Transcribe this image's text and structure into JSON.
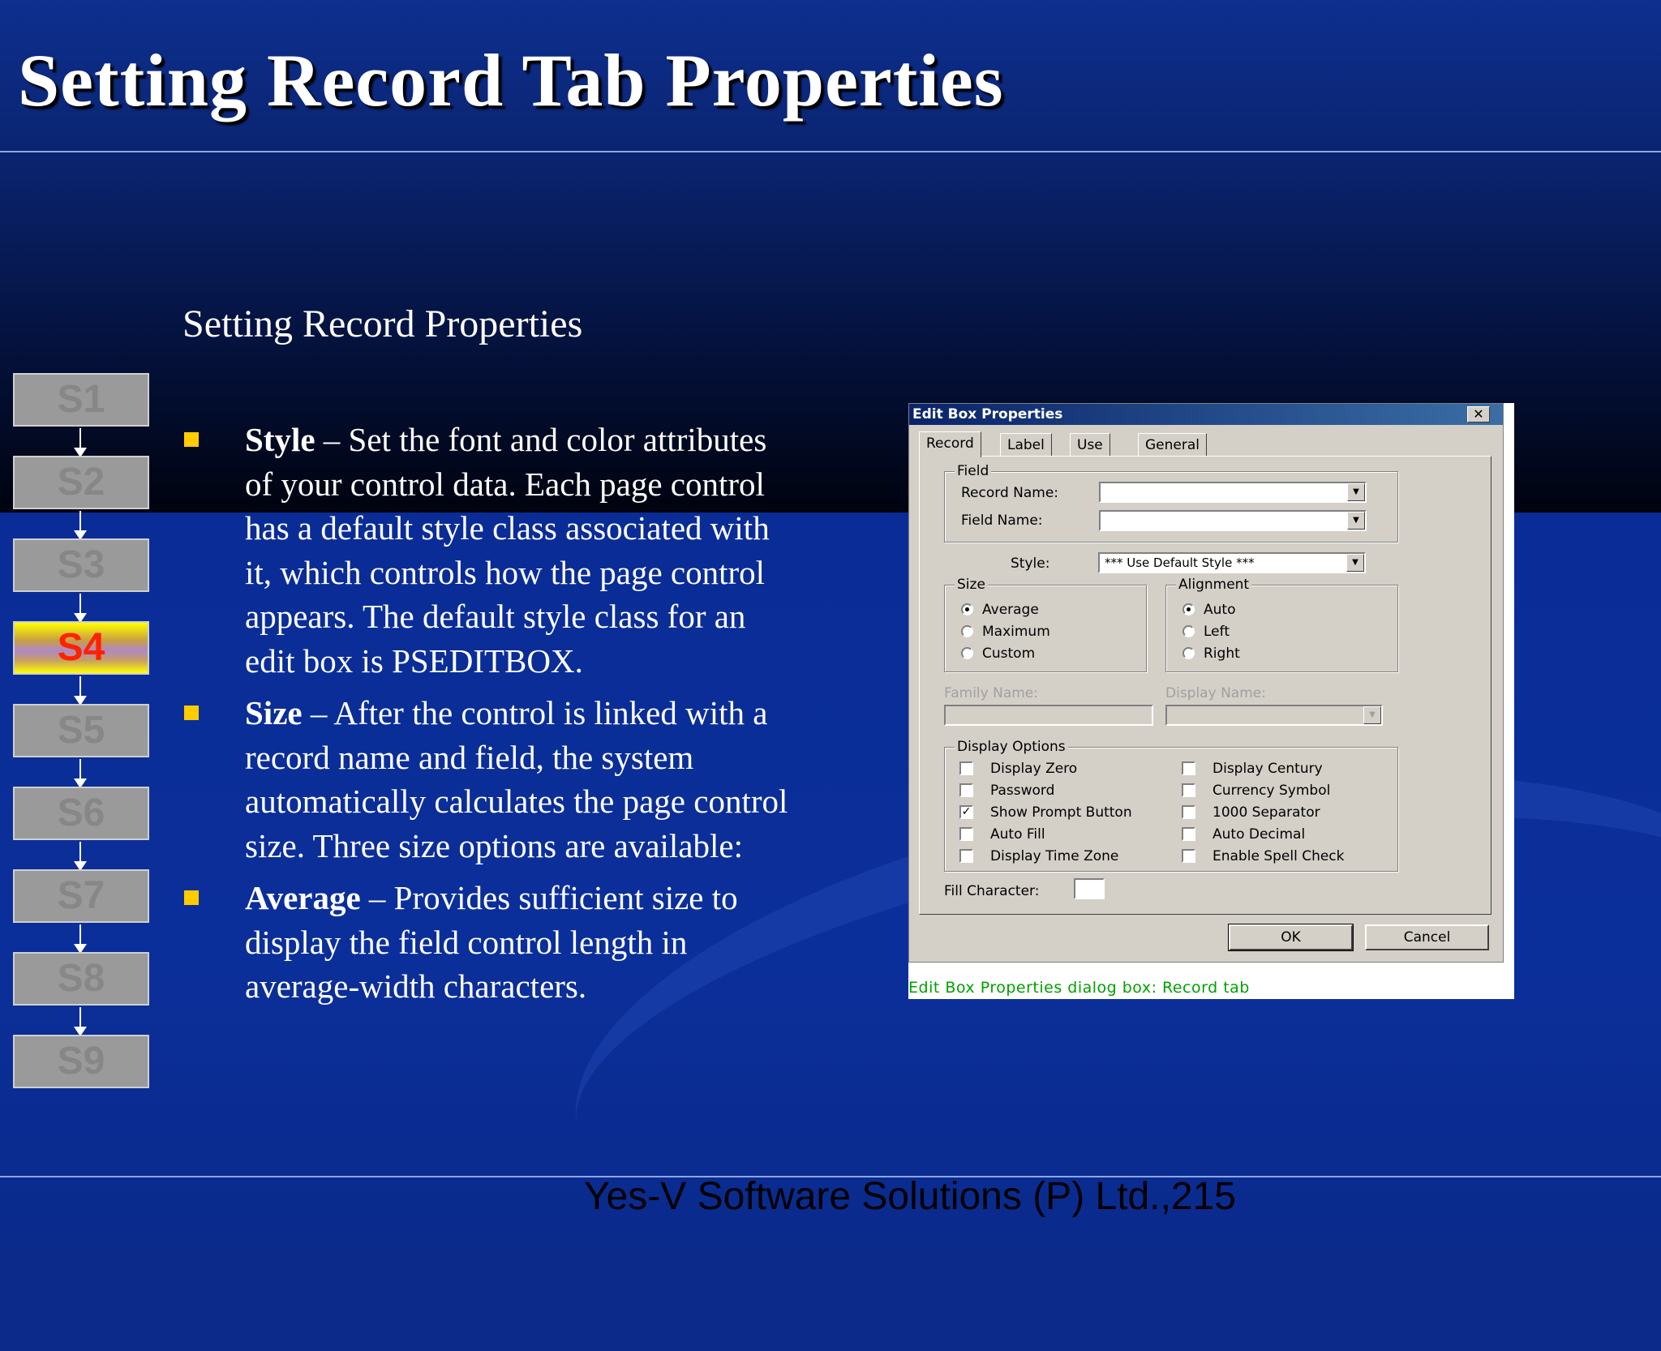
{
  "slide": {
    "title": "Setting Record Tab Properties",
    "subtitle": "Setting Record Properties",
    "footer": "Yes-V Software Solutions (P) Ltd.,215"
  },
  "steps": [
    {
      "label": "S1",
      "active": false
    },
    {
      "label": "S2",
      "active": false
    },
    {
      "label": "S3",
      "active": false
    },
    {
      "label": "S4",
      "active": true
    },
    {
      "label": "S5",
      "active": false
    },
    {
      "label": "S6",
      "active": false
    },
    {
      "label": "S7",
      "active": false
    },
    {
      "label": "S8",
      "active": false
    },
    {
      "label": "S9",
      "active": false
    }
  ],
  "bullets": [
    {
      "term": "Style",
      "text": " – Set the font and color attributes of your control data. Each page control has a default style class associated with it, which controls how the page control appears. The default style class for an edit box is PSEDITBOX."
    },
    {
      "term": "Size",
      "text": " – After the control is linked with a record name and field, the system automatically calculates the page control size. Three size options are available:"
    },
    {
      "term": "Average",
      "text": " – Provides sufficient size to display the field control length in average-width characters."
    }
  ],
  "dialog": {
    "title": "Edit Box Properties",
    "close": "✕",
    "tabs": [
      "Record",
      "Label",
      "Use",
      "General"
    ],
    "field_group": "Field",
    "record_name_label": "Record Name:",
    "record_name_value": "",
    "field_name_label": "Field Name:",
    "field_name_value": "",
    "style_label": "Style:",
    "style_value": "*** Use Default Style ***",
    "size_group": "Size",
    "size_options": [
      {
        "label": "Average",
        "selected": true
      },
      {
        "label": "Maximum",
        "selected": false
      },
      {
        "label": "Custom",
        "selected": false
      }
    ],
    "alignment_group": "Alignment",
    "alignment_options": [
      {
        "label": "Auto",
        "selected": true
      },
      {
        "label": "Left",
        "selected": false
      },
      {
        "label": "Right",
        "selected": false
      }
    ],
    "family_name_label": "Family Name:",
    "display_name_label": "Display Name:",
    "display_options_group": "Display Options",
    "display_options_left": [
      {
        "label": "Display Zero",
        "checked": false
      },
      {
        "label": "Password",
        "checked": false
      },
      {
        "label": "Show Prompt Button",
        "checked": true
      },
      {
        "label": "Auto Fill",
        "checked": false
      },
      {
        "label": "Display Time Zone",
        "checked": false
      }
    ],
    "display_options_right": [
      {
        "label": "Display Century",
        "checked": false
      },
      {
        "label": "Currency Symbol",
        "checked": false
      },
      {
        "label": "1000 Separator",
        "checked": false
      },
      {
        "label": "Auto Decimal",
        "checked": false
      },
      {
        "label": "Enable Spell Check",
        "checked": false
      }
    ],
    "fill_character_label": "Fill Character:",
    "fill_character_value": "",
    "ok_label": "OK",
    "cancel_label": "Cancel"
  },
  "caption": "Edit Box Properties dialog box: Record tab",
  "colors": {
    "bullet_marker": "#ffcc00",
    "active_step_text": "#ff2200",
    "caption_text": "#00a000"
  }
}
